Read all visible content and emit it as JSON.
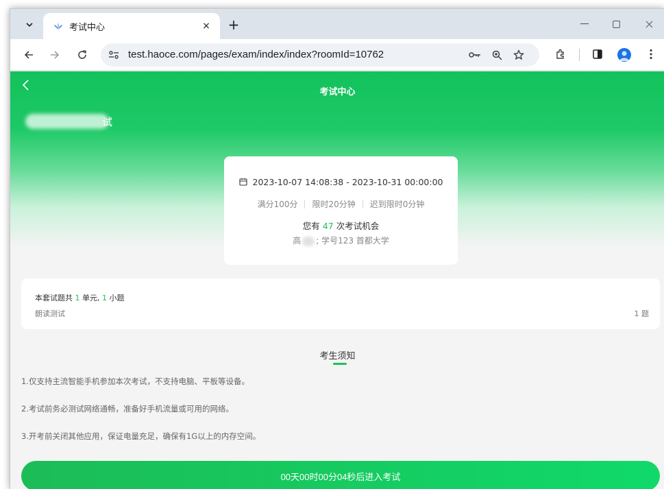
{
  "browser": {
    "tab_title": "考试中心",
    "close_glyph": "×",
    "new_tab_glyph": "+",
    "url": "test.haoce.com/pages/exam/index/index?roomId=10762"
  },
  "page": {
    "title": "考试中心",
    "exam_name_visible": "试"
  },
  "info": {
    "date_range": "2023-10-07 14:08:38 - 2023-10-31 00:00:00",
    "full_score": "满分100分",
    "time_limit": "限时20分钟",
    "late_limit": "迟到限时0分钟",
    "chance_prefix": "您有",
    "chance_count": "47",
    "chance_suffix": "次考试机会",
    "student_prefix": "高",
    "student_info": "; 学号123 首都大学"
  },
  "summary": {
    "text_a": "本套试题共",
    "units": "1",
    "text_b": "单元,",
    "questions": "1",
    "text_c": "小题",
    "section_name": "朗读测试",
    "section_count": "1 题"
  },
  "notice": {
    "title": "考生须知",
    "rules": [
      "1.仅支持主流智能手机参加本次考试，不支持电脑、平板等设备。",
      "2.考试前务必测试网络通畅，准备好手机流量或可用的网络。",
      "3.开考前关闭其他应用，保证电量充足，确保有1G以上的内存空间。"
    ]
  },
  "start_button": "00天00时00分04秒后进入考试",
  "colors": {
    "brand_green": "#1fbf5c",
    "hero_green": "#12c15c"
  },
  "icons": [
    "tab-menu-icon",
    "favicon-icon",
    "close-icon",
    "plus-icon",
    "back-arrow-icon",
    "forward-arrow-icon",
    "reload-icon",
    "site-info-icon",
    "key-icon",
    "zoom-icon",
    "star-icon",
    "extensions-icon",
    "side-panel-icon",
    "profile-icon",
    "more-icon",
    "calendar-icon",
    "back-chevron-icon"
  ]
}
